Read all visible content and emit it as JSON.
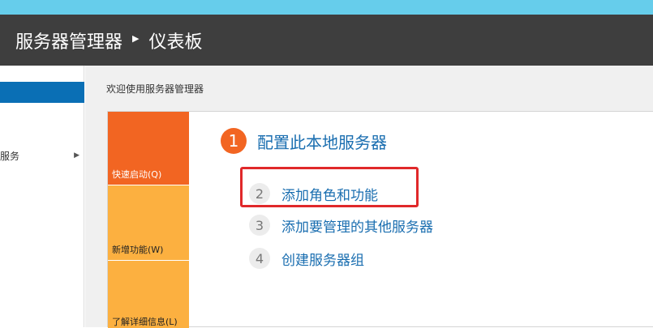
{
  "header": {
    "title": "服务器管理器",
    "separator": "▶",
    "page": "仪表板"
  },
  "sidebar": {
    "items": [
      {
        "label": "服务",
        "expand_icon": "▶"
      }
    ]
  },
  "main": {
    "welcome_label": "欢迎使用服务器管理器",
    "tiles": {
      "quick_start": "快速启动(Q)",
      "whats_new": "新增功能(W)",
      "learn_more": "了解详细信息(L)"
    },
    "steps": [
      {
        "number": "1",
        "label": "配置此本地服务器"
      },
      {
        "number": "2",
        "label": "添加角色和功能"
      },
      {
        "number": "3",
        "label": "添加要管理的其他服务器"
      },
      {
        "number": "4",
        "label": "创建服务器组"
      }
    ]
  },
  "colors": {
    "header_bg": "#3e3e3e",
    "accent_blue": "#0a6fb5",
    "tile_orange": "#f26522",
    "tile_yellow": "#fcb040",
    "link_blue": "#1a6eb0",
    "highlight_red": "#e0282a"
  }
}
